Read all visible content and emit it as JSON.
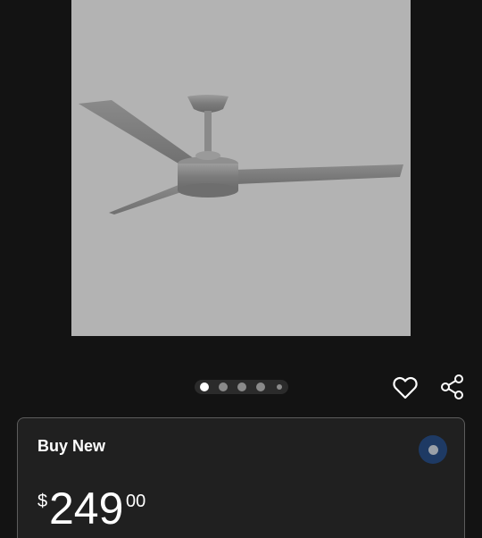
{
  "product": {
    "image_alt": "Ceiling fan with three brushed nickel blades"
  },
  "carousel": {
    "count": 5,
    "active_index": 0
  },
  "actions": {
    "favorite_icon": "heart-icon",
    "share_icon": "share-icon"
  },
  "buy_option": {
    "title": "Buy New",
    "selected": true,
    "price": {
      "currency": "$",
      "dollars": "249",
      "cents": "00"
    }
  },
  "colors": {
    "background": "#131313",
    "image_bg": "#b3b3b3",
    "card_bg": "#202020",
    "card_border": "#5d5d5d",
    "radio_accent": "#1e3a64"
  }
}
